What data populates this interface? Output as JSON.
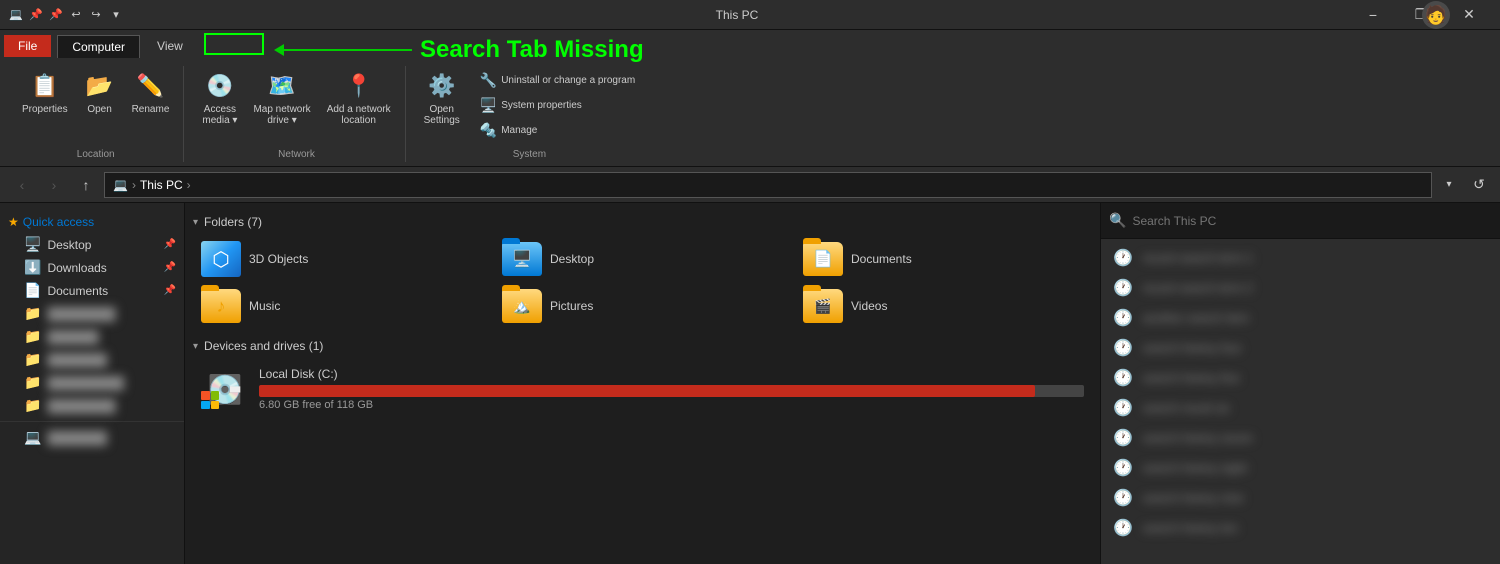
{
  "titlebar": {
    "title": "This PC",
    "minimize_label": "−",
    "maximize_label": "❐",
    "close_label": "✕",
    "restore_label": "❐"
  },
  "ribbon": {
    "tabs": [
      {
        "id": "file",
        "label": "File"
      },
      {
        "id": "computer",
        "label": "Computer"
      },
      {
        "id": "view",
        "label": "View"
      }
    ],
    "search_tab_missing_label": "Search Tab Missing",
    "groups": {
      "location": {
        "label": "Location",
        "buttons": [
          {
            "id": "properties",
            "label": "Properties",
            "icon": "🔴"
          },
          {
            "id": "open",
            "label": "Open",
            "icon": "📁"
          },
          {
            "id": "rename",
            "label": "Rename",
            "icon": "✏️"
          }
        ]
      },
      "network": {
        "label": "Network",
        "buttons": [
          {
            "id": "access-media",
            "label": "Access\nmedia ▾"
          },
          {
            "id": "map-network",
            "label": "Map network\ndrive ▾"
          },
          {
            "id": "add-location",
            "label": "Add a network\nlocation"
          }
        ]
      },
      "system": {
        "label": "System",
        "buttons": [
          {
            "id": "open-settings",
            "label": "Open\nSettings"
          },
          {
            "id": "uninstall",
            "label": "Uninstall or change a program"
          },
          {
            "id": "system-props",
            "label": "System properties"
          },
          {
            "id": "manage",
            "label": "Manage"
          }
        ]
      }
    }
  },
  "addressbar": {
    "back_title": "Back",
    "forward_title": "Forward",
    "up_title": "Up",
    "path": "This PC",
    "crumbs": [
      "This PC"
    ],
    "search_placeholder": "Search This PC"
  },
  "sidebar": {
    "quick_access_label": "Quick access",
    "items": [
      {
        "id": "desktop",
        "label": "Desktop",
        "pinned": true,
        "icon": "🖥️"
      },
      {
        "id": "downloads",
        "label": "Downloads",
        "pinned": true,
        "icon": "⬇️"
      },
      {
        "id": "documents",
        "label": "Documents",
        "pinned": true,
        "icon": "📄"
      },
      {
        "id": "blurred1",
        "label": "██████",
        "pinned": false,
        "icon": "📁",
        "blurred": true
      },
      {
        "id": "blurred2",
        "label": "██████",
        "pinned": false,
        "icon": "📁",
        "blurred": true
      },
      {
        "id": "blurred3",
        "label": "██████",
        "pinned": false,
        "icon": "📁",
        "blurred": true
      }
    ]
  },
  "content": {
    "folders_section": "Folders (7)",
    "folders_count": 7,
    "folders": [
      {
        "id": "3dobjects",
        "label": "3D Objects",
        "icon_type": "3d"
      },
      {
        "id": "desktop",
        "label": "Desktop",
        "icon_type": "blue"
      },
      {
        "id": "documents",
        "label": "Documents",
        "icon_type": "yellow"
      },
      {
        "id": "music",
        "label": "Music",
        "icon_type": "yellow"
      },
      {
        "id": "pictures",
        "label": "Pictures",
        "icon_type": "yellow"
      },
      {
        "id": "videos",
        "label": "Videos",
        "icon_type": "yellow"
      }
    ],
    "drives_section": "Devices and drives (1)",
    "drives": [
      {
        "id": "local-disk-c",
        "name": "Local Disk (C:)",
        "used_gb": 111.2,
        "total_gb": 118,
        "free_gb": 6.8,
        "fill_percent": 94,
        "space_label": "6.80 GB free of 118 GB"
      }
    ]
  },
  "search": {
    "placeholder": "Search This PC",
    "history": [
      {
        "id": "h1",
        "text": "recent search 1"
      },
      {
        "id": "h2",
        "text": "recent search 2"
      },
      {
        "id": "h3",
        "text": "recent search 3"
      },
      {
        "id": "h4",
        "text": "recent search 4"
      },
      {
        "id": "h5",
        "text": "recent search 5"
      },
      {
        "id": "h6",
        "text": "recent search 6"
      },
      {
        "id": "h7",
        "text": "recent search 7"
      },
      {
        "id": "h8",
        "text": "recent search 8"
      },
      {
        "id": "h9",
        "text": "recent search 9"
      },
      {
        "id": "h10",
        "text": "recent search 10"
      }
    ]
  },
  "annotation": {
    "text": "Search Tab Missing",
    "arrow_color": "#00cc00"
  }
}
